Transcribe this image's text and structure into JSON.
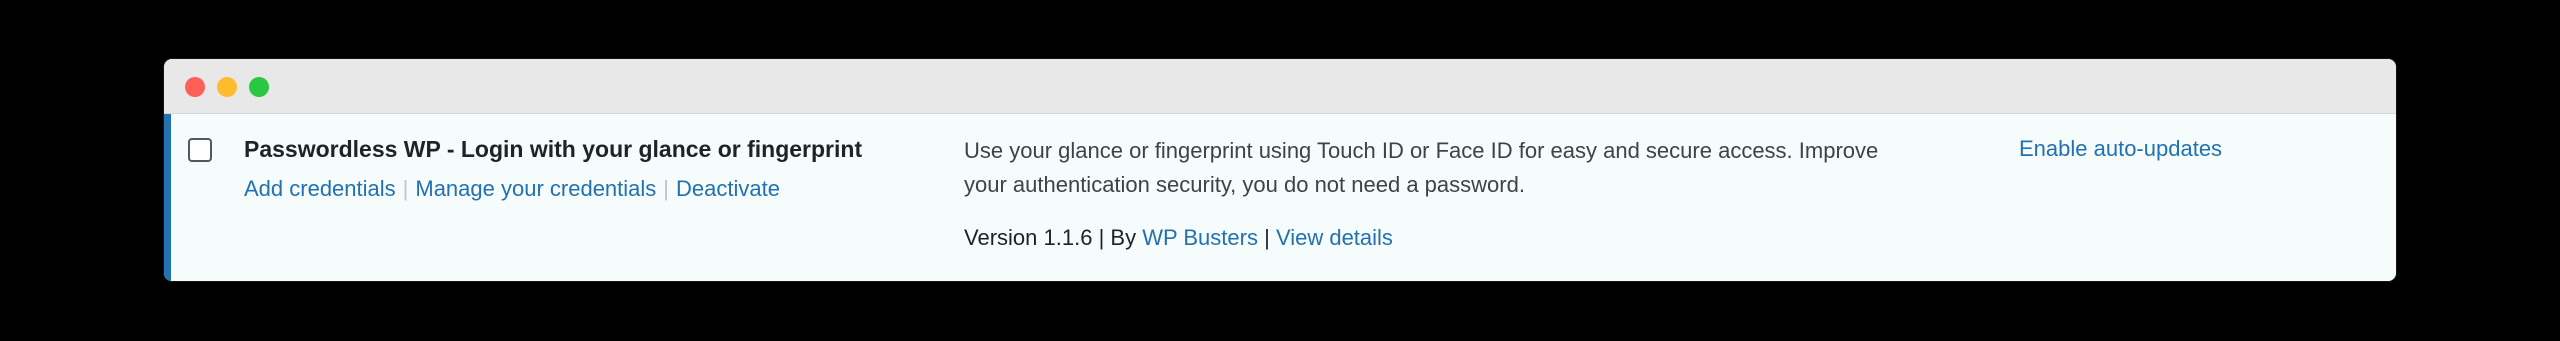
{
  "window": {
    "controls": [
      "close",
      "minimize",
      "zoom"
    ]
  },
  "plugin": {
    "name": "Passwordless WP - Login with your glance or fingerprint",
    "actions": [
      {
        "label": "Add credentials"
      },
      {
        "label": "Manage your credentials"
      },
      {
        "label": "Deactivate"
      }
    ],
    "description_line1": "Use your glance or fingerprint using Touch ID or Face ID for easy and secure access. Improve",
    "description_line2": "your authentication security, you do not need a password.",
    "version_text": "Version 1.1.6",
    "pipe": "|",
    "by_label": "By",
    "author": "WP Busters",
    "view_details": "View details",
    "auto_updates": "Enable auto-updates"
  },
  "colors": {
    "accent": "#2271b1",
    "row_background": "#f6fbfc",
    "text": "#1d2327"
  }
}
